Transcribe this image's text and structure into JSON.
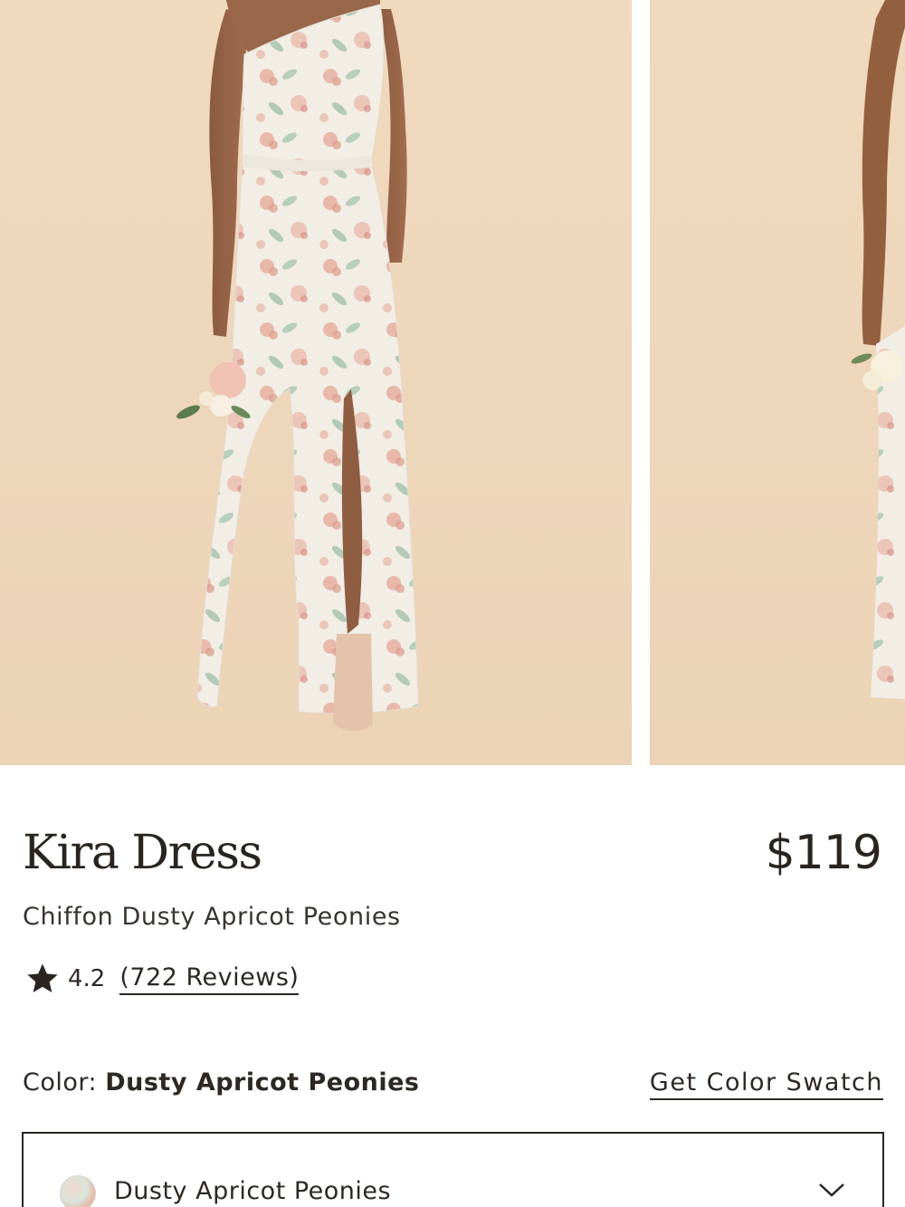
{
  "gallery": {
    "images": [
      {
        "alt_icon": "dress-photo-front"
      },
      {
        "alt_icon": "dress-photo-alt"
      }
    ]
  },
  "product": {
    "title": "Kira Dress",
    "price": "$119",
    "subtitle": "Chiffon Dusty Apricot Peonies",
    "rating": {
      "icon": "star-icon",
      "value": "4.2",
      "reviews_label": "(722 Reviews)"
    },
    "color": {
      "label": "Color:",
      "value": "Dusty Apricot Peonies",
      "swatch_link": "Get Color Swatch"
    },
    "color_select": {
      "selected": "Dusty Apricot Peonies",
      "icon": "chevron-down-icon"
    }
  },
  "colors": {
    "background": "#eed6ba",
    "text": "#2b2522",
    "dress": "#f1ece4",
    "floral_pink": "#e3a99b",
    "floral_green": "#9fbfa8"
  }
}
